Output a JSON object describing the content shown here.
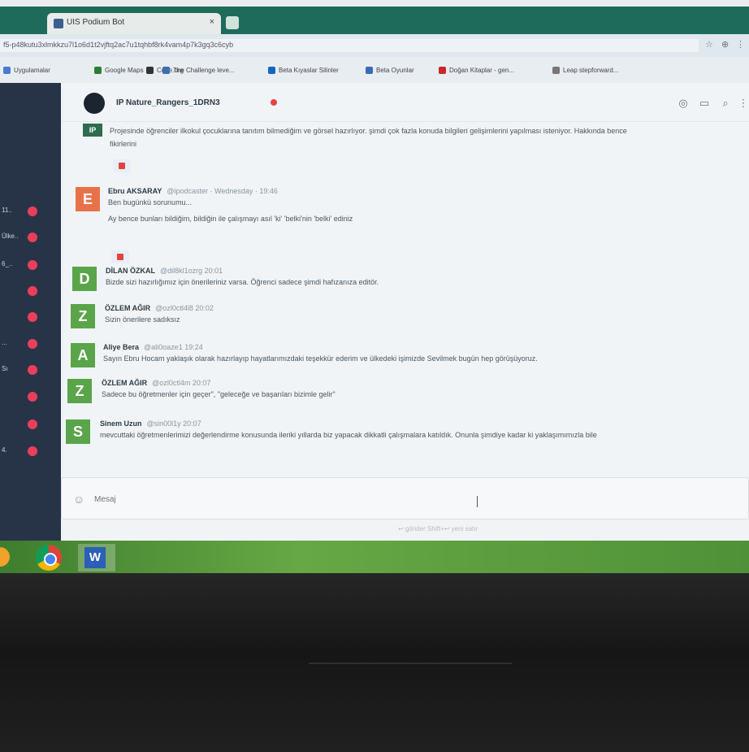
{
  "browser": {
    "tab_title": "UIS Podium Bot",
    "url": "f5-p48kutu3xlmkkzu7l1o6d1t2vjftq2ac7u1tqhbf8rk4vam4p7k3gq3c6cyb"
  },
  "bookmarks": [
    {
      "label": "Uygulamalar",
      "color": "#4a7bd0"
    },
    {
      "label": "Google Maps",
      "color": "#2e7d32"
    },
    {
      "label": "Code.org",
      "color": "#333333"
    },
    {
      "label": "The Challenge leve...",
      "color": "#3d6fb0"
    },
    {
      "label": "Beta Kıyaslar Silinler",
      "color": "#1565c0"
    },
    {
      "label": "Beta Oyunlar",
      "color": "#3a6bb8"
    },
    {
      "label": "Doğan Kitaplar - gen...",
      "color": "#c62828"
    },
    {
      "label": "Leap stepforward...",
      "color": "#777777"
    }
  ],
  "sidebar": {
    "items": [
      {
        "label": "11..",
        "badge_color": "#ec3e5b"
      },
      {
        "label": "Ülke..",
        "badge_color": "#ec3e5b"
      },
      {
        "label": "6_..",
        "badge_color": "#ec3e5b"
      },
      {
        "label": "",
        "badge_color": "#ec3e5b"
      },
      {
        "label": "",
        "badge_color": "#ec3e5b"
      },
      {
        "label": "...",
        "badge_color": "#ec3e5b"
      },
      {
        "label": "Sı",
        "badge_color": "#ec3e5b"
      },
      {
        "label": "",
        "badge_color": "#ec3e5b"
      },
      {
        "label": "",
        "badge_color": "#ec3e5b"
      },
      {
        "label": "4.",
        "badge_color": "#ec3e5b"
      }
    ]
  },
  "room": {
    "name": "IP Nature_Rangers_1DRN3",
    "status_color": "#e6434b"
  },
  "messages": [
    {
      "initial": "IP",
      "avatar_color": "#2e6b4f",
      "name": "",
      "handle": "",
      "lines": [
        "Projesinde öğrenciler ilkokul çocuklarına tanıtım bilmediğim ve görsel hazırlıyor. şimdi çok fazla konuda bilgileri gelişimlerini yapılması isteniyor. Hakkında bence",
        "fikirlerini"
      ],
      "has_reaction": true
    },
    {
      "initial": "E",
      "avatar_color": "#e7724a",
      "name": "Ebru AKSARAY",
      "handle": "@ipodcaster · Wednesday · 19:46",
      "lines": [
        "Ben bugünkü sorunumu...",
        "Ay bence bunları bildiğim, bildiğin ile çalışmayı asıl 'ki' 'belki'nin 'belki' ediniz"
      ],
      "has_reaction": true
    },
    {
      "initial": "D",
      "avatar_color": "#5aa449",
      "name": "DİLAN ÖZKAL",
      "handle": "@dil8kl1ozrg 20:01",
      "lines": [
        "Bizde sizi hazırlığımız için önerileriniz varsa. Öğrenci sadece şimdi hafızanıza editör."
      ],
      "has_reaction": false
    },
    {
      "initial": "Z",
      "avatar_color": "#5aa449",
      "name": "ÖZLEM AĞIR",
      "handle": "@ozl0ctl4l8 20:02",
      "lines": [
        "Sizin önerilere sadıksız"
      ],
      "has_reaction": false
    },
    {
      "initial": "A",
      "avatar_color": "#5aa449",
      "name": "Aliye Bera",
      "handle": "@ali0oaze1 19:24",
      "lines": [
        "Sayın Ebru Hocam yaklaşık olarak hazırlayıp hayatlarımızdaki teşekkür ederim ve ülkedeki işimizde Sevilmek bugün hep görüşüyoruz."
      ],
      "has_reaction": false
    },
    {
      "initial": "Z",
      "avatar_color": "#5aa449",
      "name": "ÖZLEM AĞIR",
      "handle": "@ozl0ctl4m 20:07",
      "lines": [
        "Sadece bu öğretmenler için geçer\", \"geleceğe ve başarıları bizimle gelir\""
      ],
      "has_reaction": false
    },
    {
      "initial": "S",
      "avatar_color": "#5aa449",
      "name": "Sinem Uzun",
      "handle": "@sin00l1y 20:07",
      "lines": [
        "mevcuttaki öğretmenlerimizi değerlendirme konusunda ileriki yıllarda biz yapacak dikkatli çalışmalara katıldık. Onunla şimdiye kadar ki yaklaşımımızla bile"
      ],
      "has_reaction": false
    }
  ],
  "composer": {
    "placeholder": "Mesaj",
    "typing_hint": "↩ gönder    Shift+↩ yeni satır"
  }
}
